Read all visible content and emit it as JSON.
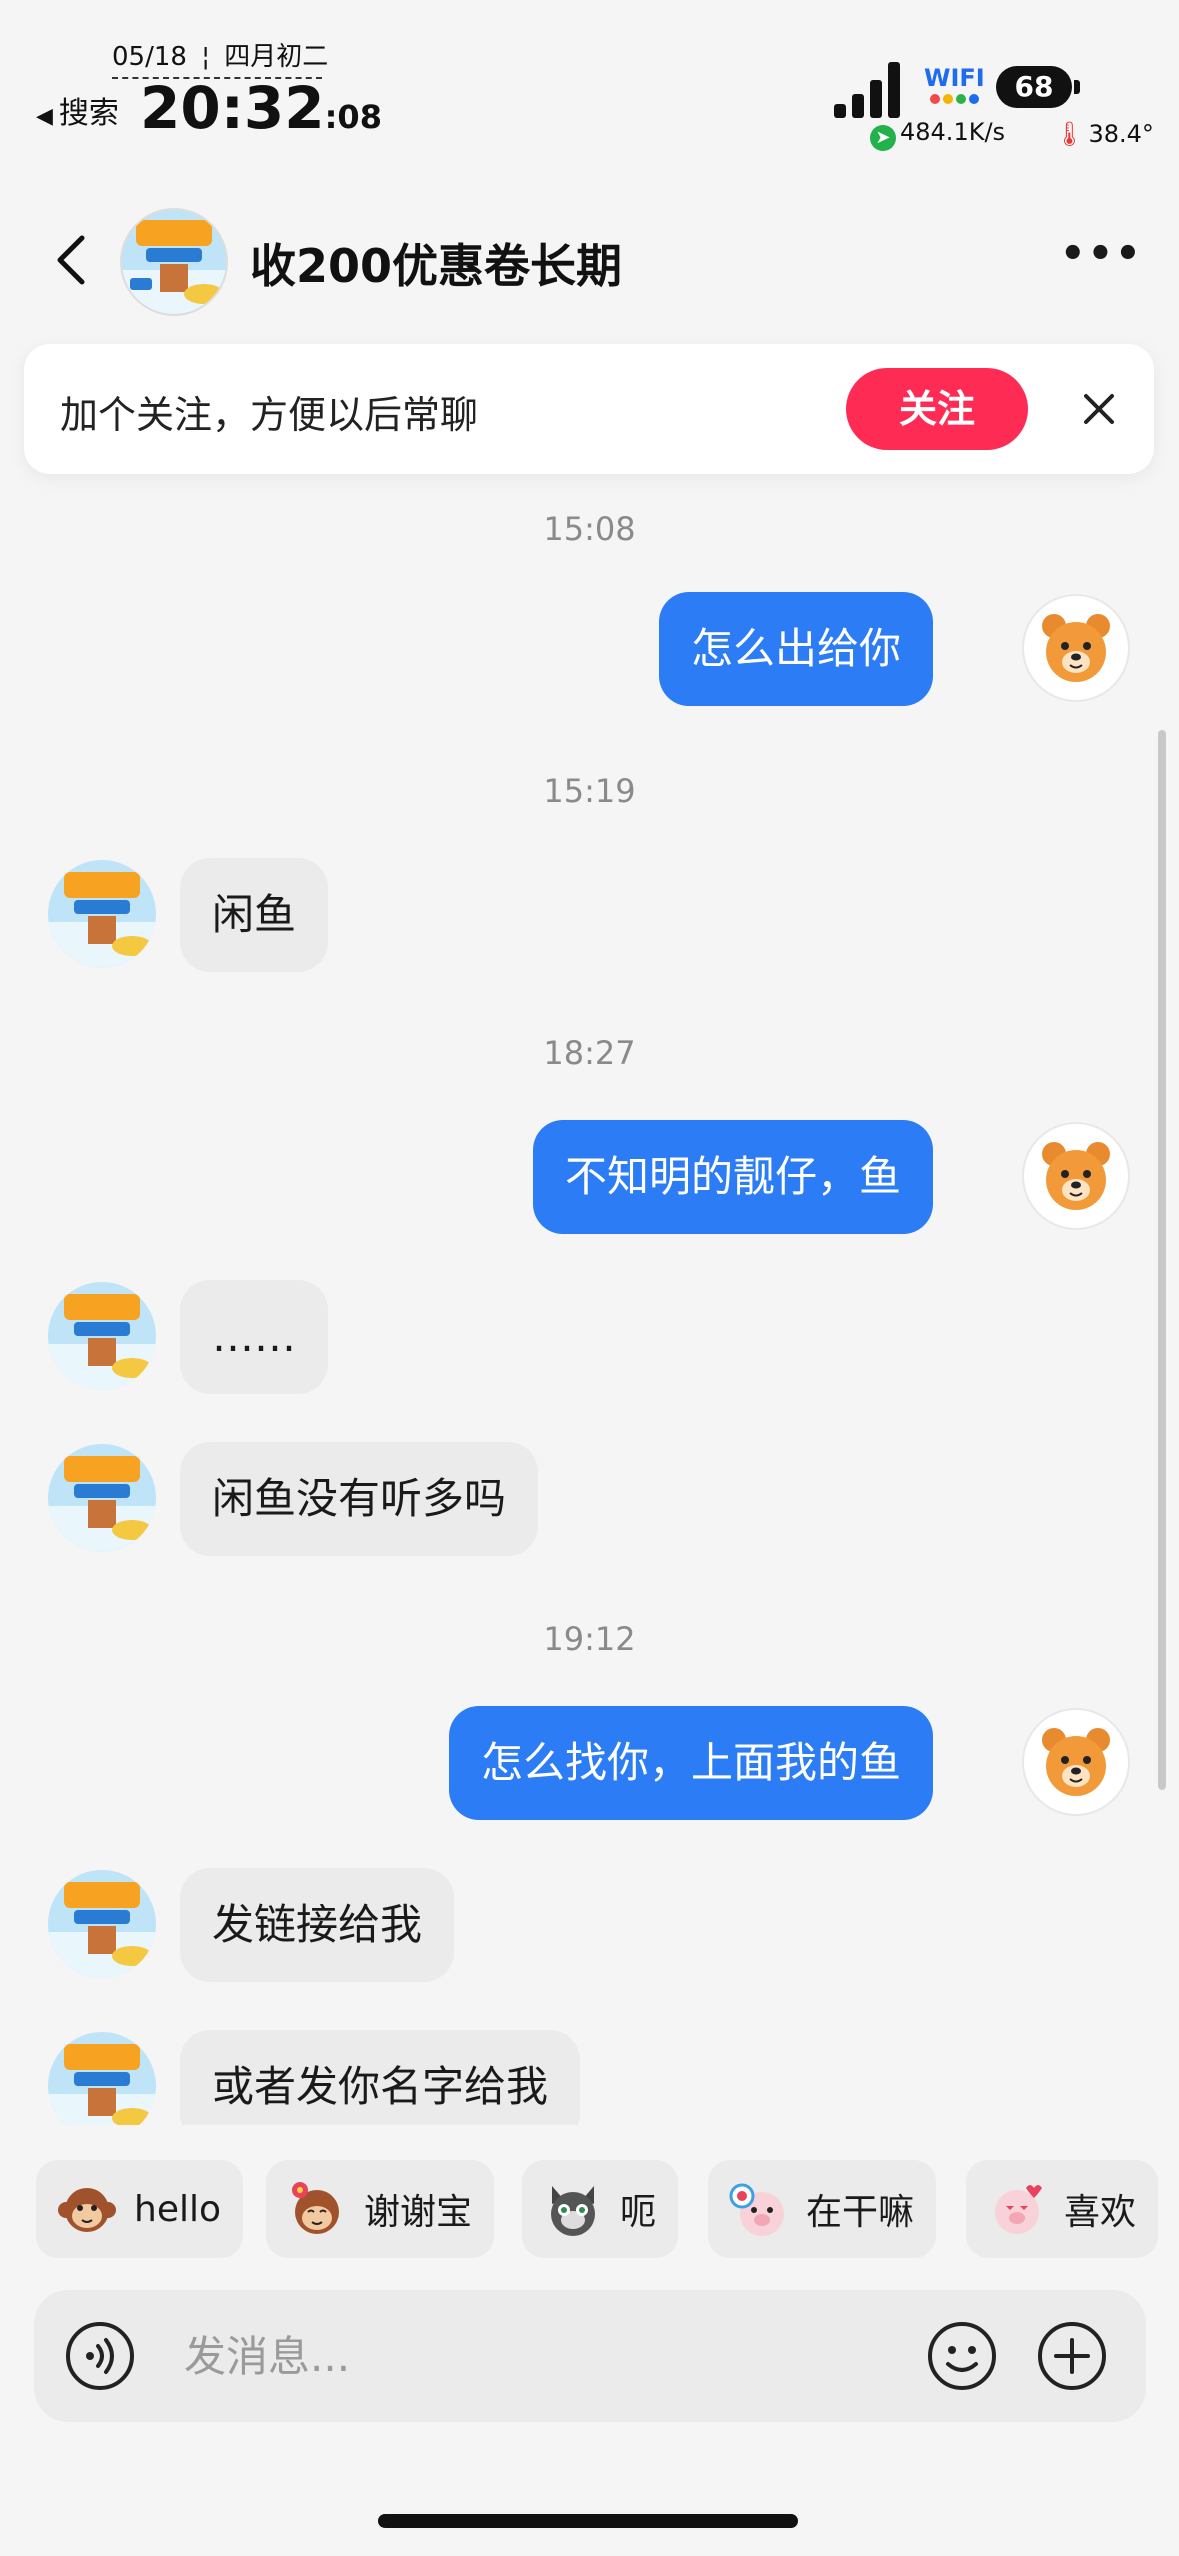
{
  "status_bar": {
    "date": "05/18",
    "lunar": "四月初二",
    "back_app": "搜索",
    "time_main": "20:32",
    "time_seconds": ":08",
    "wifi_label": "WIFI",
    "battery": "68",
    "net_speed": "484.1K/s",
    "temperature": "38.4°"
  },
  "header": {
    "title": "收200优惠卷长期"
  },
  "follow_card": {
    "text": "加个关注，方便以后常聊",
    "button": "关注"
  },
  "messages": [
    {
      "type": "time",
      "text": "15:08"
    },
    {
      "type": "out",
      "text": "怎么出给你"
    },
    {
      "type": "time",
      "text": "15:19"
    },
    {
      "type": "in",
      "text": "闲鱼"
    },
    {
      "type": "time",
      "text": "18:27"
    },
    {
      "type": "out",
      "text": "不知明的靓仔，鱼"
    },
    {
      "type": "in",
      "text": "……"
    },
    {
      "type": "in",
      "text": "闲鱼没有听多吗"
    },
    {
      "type": "time",
      "text": "19:12"
    },
    {
      "type": "out",
      "text": "怎么找你，上面我的鱼"
    },
    {
      "type": "in",
      "text": "发链接给我"
    },
    {
      "type": "in",
      "text": "或者发你名字给我"
    }
  ],
  "quick_replies": [
    {
      "label": "hello",
      "icon": "monkey-emoji-icon"
    },
    {
      "label": "谢谢宝",
      "icon": "monkey-flower-emoji-icon"
    },
    {
      "label": "呃",
      "icon": "cat-emoji-icon"
    },
    {
      "label": "在干嘛",
      "icon": "pig-lollipop-emoji-icon"
    },
    {
      "label": "喜欢",
      "icon": "pig-love-emoji-icon"
    }
  ],
  "input": {
    "placeholder": "发消息..."
  },
  "colors": {
    "accent_blue": "#2c7cf6",
    "follow_red": "#fe2c55",
    "bubble_gray": "#ebebeb"
  }
}
